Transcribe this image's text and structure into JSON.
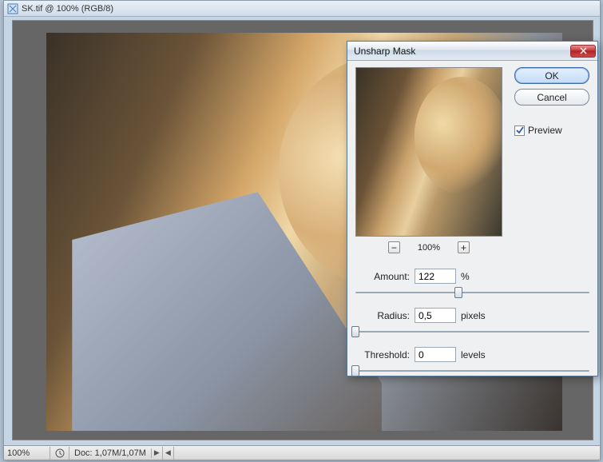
{
  "document": {
    "title": "SK.tif @ 100% (RGB/8)",
    "zoom": "100%",
    "doc_info": "Doc: 1,07M/1,07M"
  },
  "dialog": {
    "title": "Unsharp Mask",
    "ok_label": "OK",
    "cancel_label": "Cancel",
    "preview_label": "Preview",
    "preview_checked": true,
    "zoom_value": "100%",
    "amount_label": "Amount:",
    "amount_value": "122",
    "amount_unit": "%",
    "amount_slider_percent": 44,
    "radius_label": "Radius:",
    "radius_value": "0,5",
    "radius_unit": "pixels",
    "radius_slider_percent": 0,
    "threshold_label": "Threshold:",
    "threshold_value": "0",
    "threshold_unit": "levels",
    "threshold_slider_percent": 0
  }
}
